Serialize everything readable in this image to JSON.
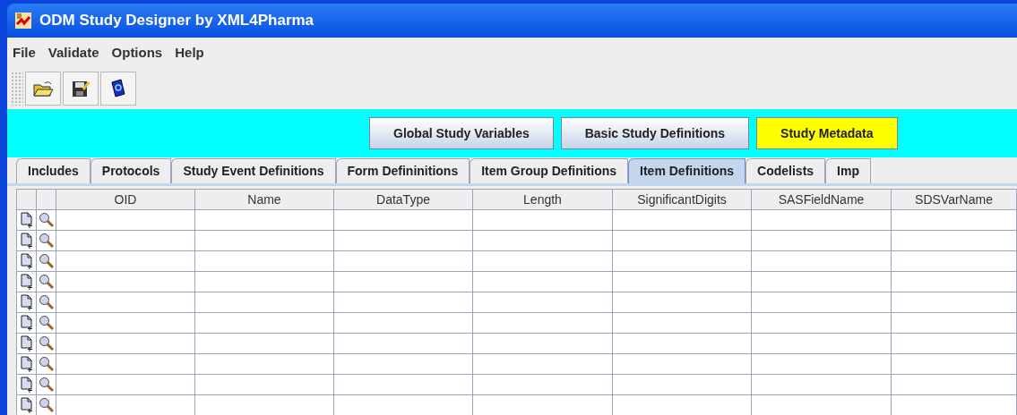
{
  "window": {
    "title": "ODM Study Designer by XML4Pharma"
  },
  "menu": [
    "File",
    "Validate",
    "Options",
    "Help"
  ],
  "toolbar": [
    {
      "kind": "open"
    },
    {
      "kind": "save"
    },
    {
      "kind": "help"
    }
  ],
  "sections": [
    {
      "label": "Global Study Variables",
      "selected": false
    },
    {
      "label": "Basic Study Definitions",
      "selected": false
    },
    {
      "label": "Study Metadata",
      "selected": true
    }
  ],
  "tabs": [
    {
      "label": "Includes",
      "selected": false
    },
    {
      "label": "Protocols",
      "selected": false
    },
    {
      "label": "Study Event Definitions",
      "selected": false
    },
    {
      "label": "Form Defininitions",
      "selected": false
    },
    {
      "label": "Item Group Definitions",
      "selected": false
    },
    {
      "label": "Item Definitions",
      "selected": true
    },
    {
      "label": "Codelists",
      "selected": false
    },
    {
      "label": "Imp",
      "selected": false
    }
  ],
  "table": {
    "columns": [
      "OID",
      "Name",
      "DataType",
      "Length",
      "SignificantDigits",
      "SASFieldName",
      "SDSVarName"
    ],
    "rows": [
      {
        "kind": "empty"
      },
      {
        "kind": "empty"
      },
      {
        "kind": "empty"
      },
      {
        "kind": "empty"
      },
      {
        "kind": "empty"
      },
      {
        "kind": "empty"
      },
      {
        "kind": "empty"
      },
      {
        "kind": "empty"
      },
      {
        "kind": "empty"
      },
      {
        "kind": "empty"
      }
    ]
  }
}
